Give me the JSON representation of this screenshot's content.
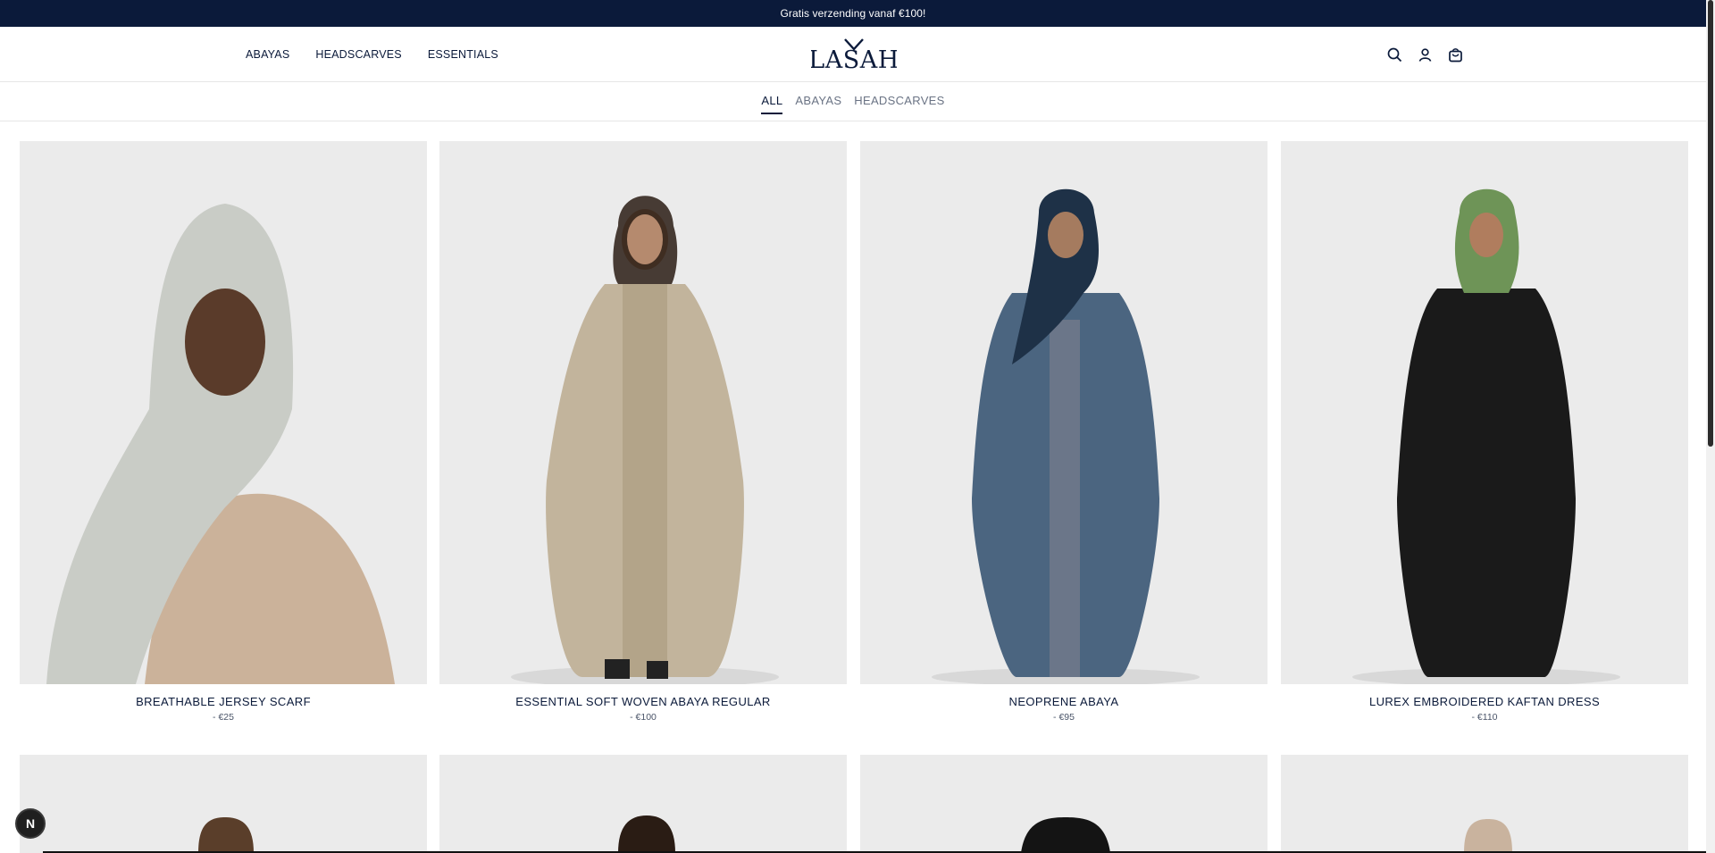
{
  "announcement": "Gratis verzending vanaf €100!",
  "header": {
    "nav": [
      "ABAYAS",
      "HEADSCARVES",
      "ESSENTIALS"
    ],
    "logo_text": "LASAH",
    "icons": [
      "search-icon",
      "account-icon",
      "cart-icon"
    ]
  },
  "subnav": {
    "tabs": [
      "ALL",
      "ABAYAS",
      "HEADSCARVES"
    ],
    "active": "ALL"
  },
  "products": [
    {
      "title": "BREATHABLE JERSEY SCARF",
      "price": "- €25",
      "color": "#c9ccc6"
    },
    {
      "title": "ESSENTIAL SOFT WOVEN ABAYA REGULAR",
      "price": "- €100",
      "color": "#c2b49c"
    },
    {
      "title": "NEOPRENE ABAYA",
      "price": "- €95",
      "color": "#4b6580"
    },
    {
      "title": "LUREX EMBROIDERED KAFTAN DRESS",
      "price": "- €110",
      "color": "#1a1a1a"
    }
  ],
  "floating_badge": "N",
  "colors": {
    "brand": "#0b1a3a",
    "image_bg": "#ebebeb"
  }
}
